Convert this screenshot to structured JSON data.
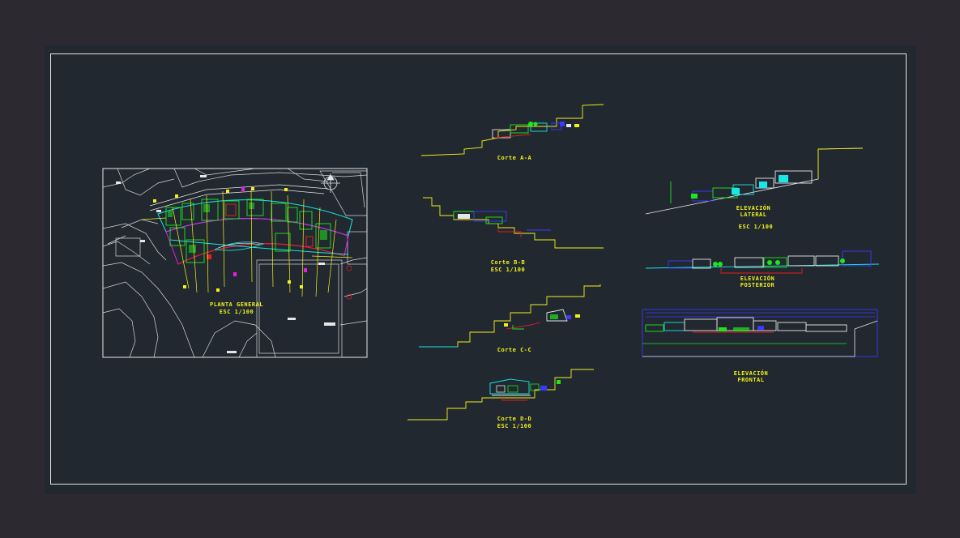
{
  "colors": {
    "canvas": "#212830",
    "outer": "#2d2930",
    "frame": "#e6e6e6",
    "yellow": "#f2f21a",
    "cyan": "#19e6e6",
    "green": "#1ee61e",
    "blue": "#3a3aff",
    "red": "#e61e1e",
    "white": "#e6e6e6",
    "magenta": "#e61ee6"
  },
  "labels": {
    "plan_title": "PLANTA GENERAL",
    "plan_scale": "ESC 1/100",
    "corte_aa": "Corte A-A",
    "corte_bb": "Corte B-B",
    "corte_bb_scale": "ESC 1/100",
    "corte_cc": "Corte C-C",
    "corte_dd": "Corte D-D",
    "corte_dd_scale": "ESC 1/100",
    "elev_lateral_1": "ELEVACIÓN",
    "elev_lateral_2": "LATERAL",
    "elev_lateral_scale": "ESC 1/100",
    "elev_posterior_1": "ELEVACIÓN",
    "elev_posterior_2": "POSTERIOR",
    "elev_frontal_1": "ELEVACIÓN",
    "elev_frontal_2": "FRONTAL"
  }
}
